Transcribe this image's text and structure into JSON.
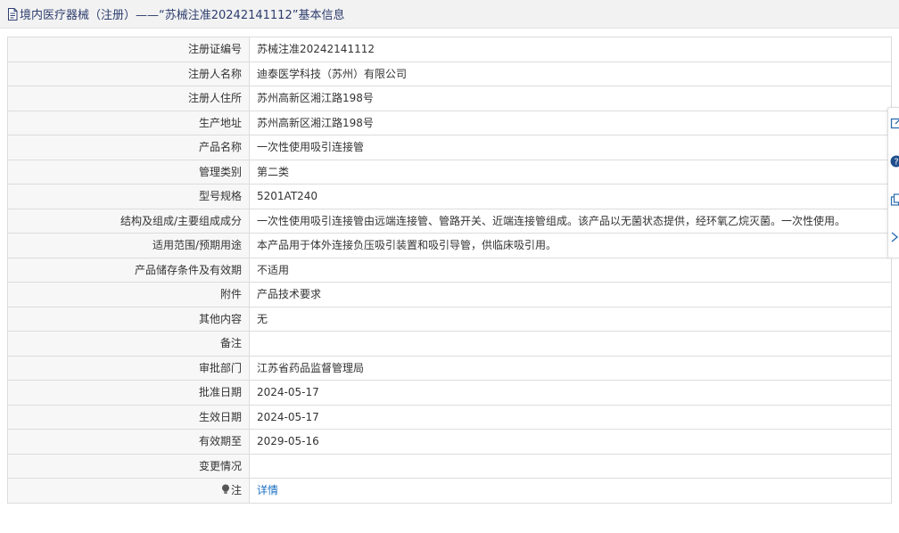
{
  "header": {
    "title": "境内医疗器械（注册）——“苏械注准20242141112”基本信息"
  },
  "rows": [
    {
      "label": "注册证编号",
      "value": "苏械注准20242141112"
    },
    {
      "label": "注册人名称",
      "value": "迪泰医学科技（苏州）有限公司"
    },
    {
      "label": "注册人住所",
      "value": "苏州高新区湘江路198号"
    },
    {
      "label": "生产地址",
      "value": "苏州高新区湘江路198号"
    },
    {
      "label": "产品名称",
      "value": "一次性使用吸引连接管"
    },
    {
      "label": "管理类别",
      "value": "第二类"
    },
    {
      "label": "型号规格",
      "value": "5201AT240"
    },
    {
      "label": "结构及组成/主要组成成分",
      "value": "一次性使用吸引连接管由远端连接管、管路开关、近端连接管组成。该产品以无菌状态提供，经环氧乙烷灭菌。一次性使用。"
    },
    {
      "label": "适用范围/预期用途",
      "value": "本产品用于体外连接负压吸引装置和吸引导管，供临床吸引用。"
    },
    {
      "label": "产品储存条件及有效期",
      "value": "不适用"
    },
    {
      "label": "附件",
      "value": "产品技术要求"
    },
    {
      "label": "其他内容",
      "value": "无"
    },
    {
      "label": "备注",
      "value": ""
    },
    {
      "label": "审批部门",
      "value": "江苏省药品监督管理局"
    },
    {
      "label": "批准日期",
      "value": "2024-05-17"
    },
    {
      "label": "生效日期",
      "value": "2024-05-17"
    },
    {
      "label": "有效期至",
      "value": "2029-05-16"
    },
    {
      "label": "变更情况",
      "value": ""
    }
  ],
  "note_row": {
    "label": "注",
    "link": "详情"
  },
  "icons": {
    "header_icon": "document-icon",
    "note_icon": "bulb-icon",
    "side_tools": [
      "edit-icon",
      "help-icon",
      "copy-icon",
      "collapse-icon"
    ]
  },
  "colors": {
    "header_text": "#2d3d6e",
    "link": "#1a6fc2",
    "label_bg": "#f7f7f7",
    "border": "#dcdcdc"
  }
}
